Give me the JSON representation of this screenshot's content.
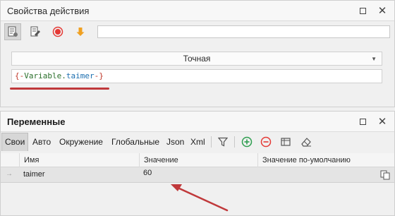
{
  "action_panel": {
    "title": "Свойства действия",
    "mode_select": {
      "selected": "Точная"
    },
    "value_field": {
      "open": "{-",
      "keyword": "Variable",
      "dot": ".",
      "name": "taimer",
      "close": "-}"
    }
  },
  "variables_panel": {
    "title": "Переменные",
    "tabs": [
      {
        "label": "Свои"
      },
      {
        "label": "Авто"
      },
      {
        "label": "Окружение"
      },
      {
        "label": "Глобальные"
      },
      {
        "label": "Json"
      },
      {
        "label": "Xml"
      }
    ],
    "columns": [
      {
        "label": "Имя"
      },
      {
        "label": "Значение"
      },
      {
        "label": "Значение по-умолчанию"
      }
    ],
    "rows": [
      {
        "name": "taimer",
        "value": "60",
        "default": ""
      }
    ]
  },
  "colors": {
    "accent_red": "#c0393b",
    "record_red": "#e53935",
    "arrow_orange": "#f0a020",
    "add_green": "#2e9e4f"
  },
  "icons": [
    "properties-icon",
    "edit-icon",
    "record-icon",
    "arrow-down-icon",
    "filter-icon",
    "add-icon",
    "remove-icon",
    "columns-icon",
    "eraser-icon",
    "copy-icon",
    "maximize-icon",
    "close-icon"
  ]
}
